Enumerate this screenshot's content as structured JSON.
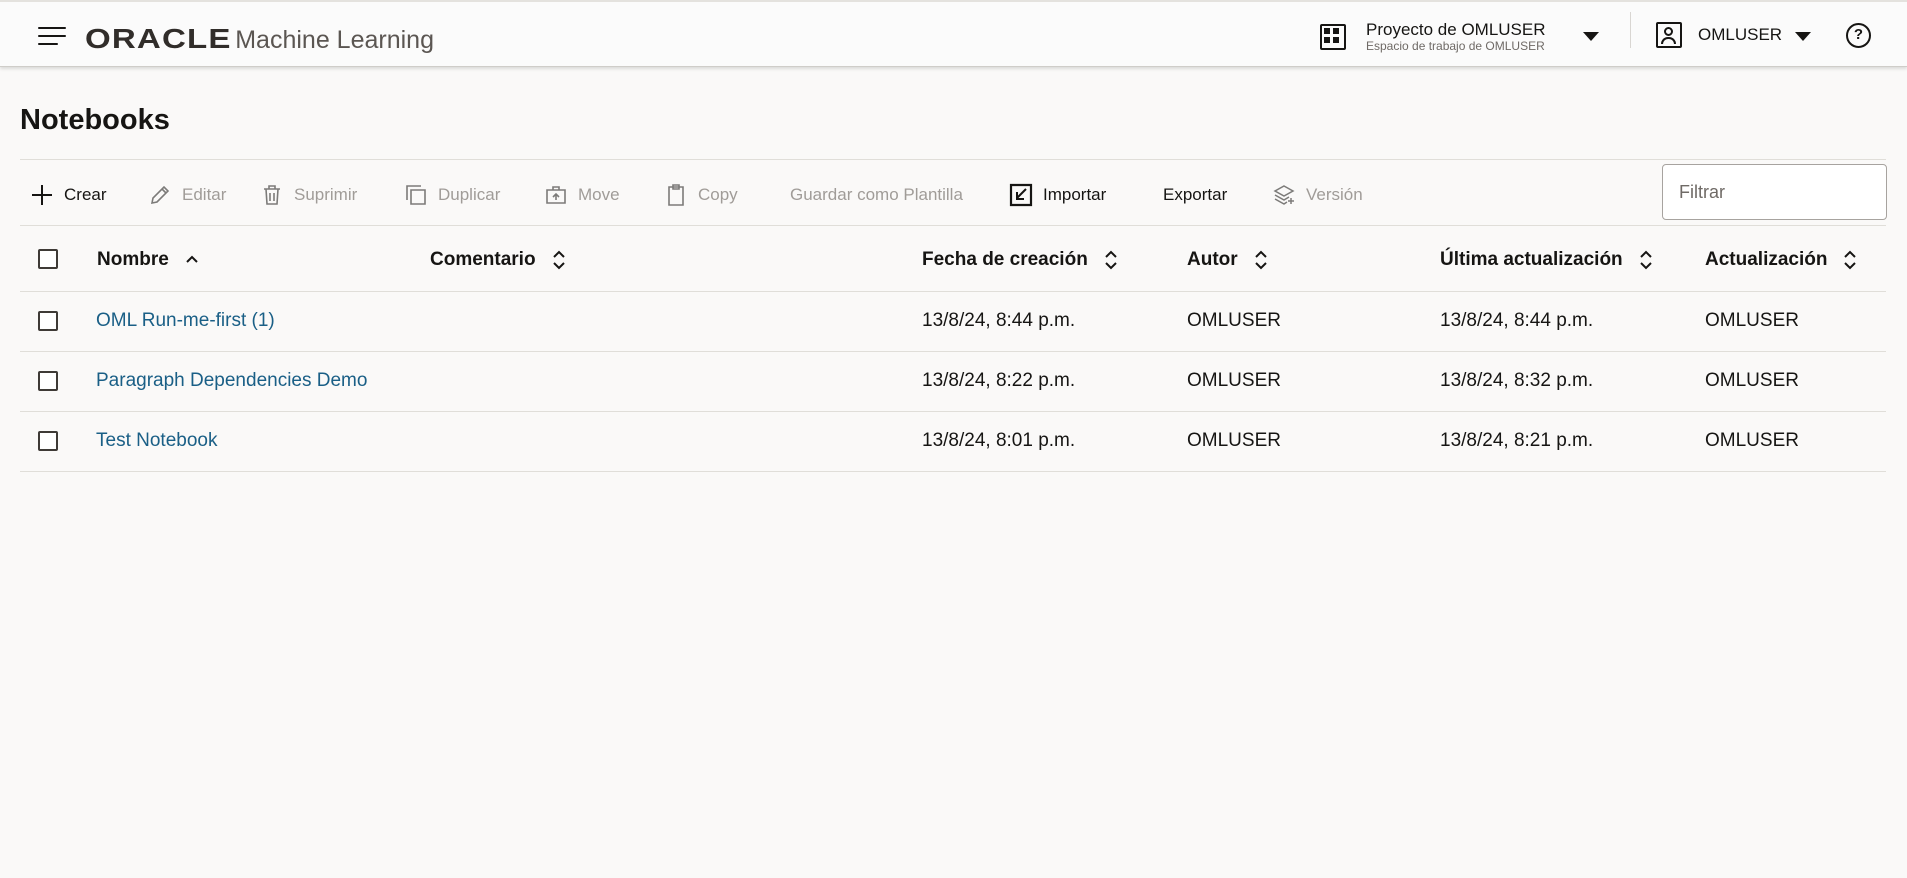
{
  "header": {
    "brand_oracle": "ORACLE",
    "brand_product": "Machine Learning",
    "project_name": "Proyecto de OMLUSER",
    "project_workspace": "Espacio de trabajo de OMLUSER",
    "user_name": "OMLUSER",
    "help_symbol": "?"
  },
  "page": {
    "title": "Notebooks"
  },
  "toolbar": {
    "create": "Crear",
    "edit": "Editar",
    "delete": "Suprimir",
    "duplicate": "Duplicar",
    "move": "Move",
    "copy": "Copy",
    "save_template": "Guardar como Plantilla",
    "import": "Importar",
    "export": "Exportar",
    "version": "Versión",
    "filter_placeholder": "Filtrar"
  },
  "table": {
    "columns": {
      "name": "Nombre",
      "comment": "Comentario",
      "created": "Fecha de creación",
      "author": "Autor",
      "last_updated": "Última actualización",
      "updated_by": "Actualización"
    },
    "rows": [
      {
        "name": "OML Run-me-first (1)",
        "comment": "",
        "created": "13/8/24, 8:44 p.m.",
        "author": "OMLUSER",
        "last_updated": "13/8/24, 8:44 p.m.",
        "updated_by": "OMLUSER"
      },
      {
        "name": "Paragraph Dependencies Demo",
        "comment": "",
        "created": "13/8/24, 8:22 p.m.",
        "author": "OMLUSER",
        "last_updated": "13/8/24, 8:32 p.m.",
        "updated_by": "OMLUSER"
      },
      {
        "name": "Test Notebook",
        "comment": "",
        "created": "13/8/24, 8:01 p.m.",
        "author": "OMLUSER",
        "last_updated": "13/8/24, 8:21 p.m.",
        "updated_by": "OMLUSER"
      }
    ]
  },
  "icons": {
    "menu": "hamburger-menu-icon",
    "project": "grid-icon",
    "user": "user-icon",
    "help": "help-icon",
    "create": "plus-icon",
    "edit": "pencil-icon",
    "delete": "trash-icon",
    "duplicate": "duplicate-icon",
    "move": "move-icon",
    "copy": "clipboard-icon",
    "import": "import-icon",
    "version": "layers-icon"
  },
  "colors": {
    "link": "#1a5f86",
    "disabled_text": "#a09c98",
    "background": "#faf9f8"
  }
}
